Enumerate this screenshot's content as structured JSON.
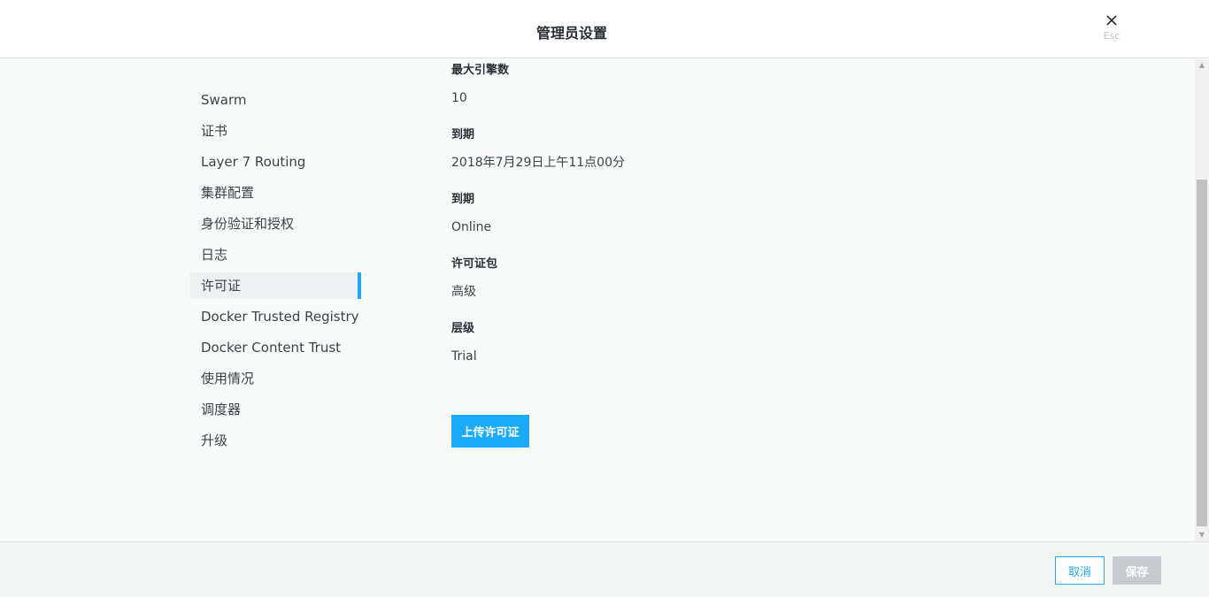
{
  "header": {
    "title": "管理员设置",
    "close_hint": "Esc"
  },
  "nav": {
    "items": [
      {
        "label": "Swarm"
      },
      {
        "label": "证书"
      },
      {
        "label": "Layer 7 Routing"
      },
      {
        "label": "集群配置"
      },
      {
        "label": "身份验证和授权"
      },
      {
        "label": "日志"
      },
      {
        "label": "许可证",
        "active": true
      },
      {
        "label": "Docker Trusted Registry"
      },
      {
        "label": "Docker Content Trust"
      },
      {
        "label": "使用情况"
      },
      {
        "label": "调度器"
      },
      {
        "label": "升级"
      }
    ]
  },
  "license": {
    "fields": [
      {
        "label": "最大引擎数",
        "value": "10"
      },
      {
        "label": "到期",
        "value": "2018年7月29日上午11点00分"
      },
      {
        "label": "到期",
        "value": "Online"
      },
      {
        "label": "许可证包",
        "value": "高级"
      },
      {
        "label": "层级",
        "value": "Trial"
      }
    ],
    "upload_label": "上传许可证"
  },
  "footer": {
    "cancel_label": "取消",
    "save_label": "保存"
  },
  "colors": {
    "accent": "#1aaaf8",
    "disabled": "#c8ccd0"
  }
}
